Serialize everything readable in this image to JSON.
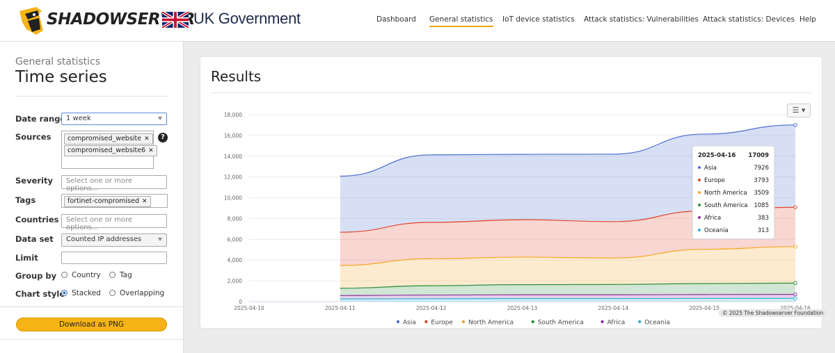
{
  "header": {
    "logo_text": "SHADOWSERVER",
    "partner": "UK Government",
    "nav": [
      {
        "label": "Dashboard",
        "active": false
      },
      {
        "label": "General statistics",
        "active": true
      },
      {
        "label": "IoT device statistics",
        "active": false
      },
      {
        "label": "Attack statistics: Vulnerabilities",
        "active": false
      },
      {
        "label": "Attack statistics: Devices",
        "active": false
      },
      {
        "label": "Help",
        "active": false
      }
    ]
  },
  "sidebar": {
    "breadcrumb": "General statistics",
    "title": "Time series",
    "date_range": {
      "label": "Date range",
      "value": "1 week"
    },
    "sources": {
      "label": "Sources",
      "chips": [
        "compromised_website",
        "compromised_website6"
      ],
      "help": "?"
    },
    "severity": {
      "label": "Severity",
      "placeholder": "Select one or more options..."
    },
    "tags": {
      "label": "Tags",
      "chips": [
        "fortinet-compromised"
      ]
    },
    "countries": {
      "label": "Countries",
      "placeholder": "Select one or more options..."
    },
    "data_set": {
      "label": "Data set",
      "value": "Counted IP addresses"
    },
    "limit": {
      "label": "Limit",
      "value": ""
    },
    "group_by": {
      "label": "Group by",
      "options": [
        "Country",
        "Tag"
      ],
      "selected": null
    },
    "chart_style": {
      "label": "Chart style",
      "options": [
        "Stacked",
        "Overlapping"
      ],
      "selected": "Stacked"
    },
    "download": "Download as PNG"
  },
  "results": {
    "title": "Results",
    "credit": "© 2025 The Shadowserver Foundation",
    "tooltip": {
      "date": "2025-04-16",
      "total": "17009",
      "rows": [
        {
          "name": "Asia",
          "value": "7926"
        },
        {
          "name": "Europe",
          "value": "3793"
        },
        {
          "name": "North America",
          "value": "3509"
        },
        {
          "name": "South America",
          "value": "1085"
        },
        {
          "name": "Africa",
          "value": "383"
        },
        {
          "name": "Oceania",
          "value": "313"
        }
      ]
    }
  },
  "chart_data": {
    "type": "area",
    "stacked": true,
    "x": [
      "2025-04-10",
      "2025-04-11",
      "2025-04-12",
      "2025-04-13",
      "2025-04-14",
      "2025-04-15",
      "2025-04-16"
    ],
    "ylim": [
      0,
      18000
    ],
    "yticks": [
      "0",
      "2,000",
      "4,000",
      "6,000",
      "8,000",
      "10,000",
      "12,000",
      "14,000",
      "16,000",
      "18,000"
    ],
    "grid": true,
    "legend_position": "bottom",
    "series": [
      {
        "name": "Oceania",
        "color": "#2bb0d8",
        "values": [
          null,
          250,
          280,
          290,
          290,
          305,
          313
        ]
      },
      {
        "name": "Africa",
        "color": "#8e2f9e",
        "values": [
          null,
          330,
          350,
          360,
          360,
          375,
          383
        ]
      },
      {
        "name": "South America",
        "color": "#2f8f3a",
        "values": [
          null,
          700,
          900,
          980,
          1000,
          1050,
          1085
        ]
      },
      {
        "name": "North America",
        "color": "#f5a623",
        "values": [
          null,
          2200,
          2600,
          2650,
          2550,
          3300,
          3509
        ]
      },
      {
        "name": "Europe",
        "color": "#e0452c",
        "values": [
          null,
          3200,
          3500,
          3600,
          3500,
          3700,
          3793
        ]
      },
      {
        "name": "Asia",
        "color": "#4a6fd1",
        "values": [
          null,
          5400,
          6500,
          6300,
          6500,
          7400,
          7926
        ]
      }
    ],
    "legend_order": [
      "Asia",
      "Europe",
      "North America",
      "South America",
      "Africa",
      "Oceania"
    ]
  }
}
